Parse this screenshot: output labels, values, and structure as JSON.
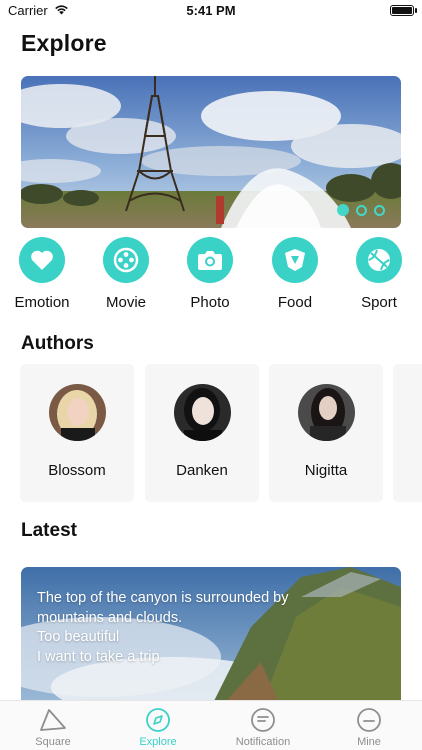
{
  "status_bar": {
    "carrier": "Carrier",
    "time": "5:41 PM",
    "battery_level": 1.0
  },
  "header": {
    "title": "Explore"
  },
  "banner": {
    "slides": 3,
    "active_slide": 1
  },
  "categories": [
    {
      "label": "Emotion",
      "icon": "heart-icon"
    },
    {
      "label": "Movie",
      "icon": "film-reel-icon"
    },
    {
      "label": "Photo",
      "icon": "camera-icon"
    },
    {
      "label": "Food",
      "icon": "food-icon"
    },
    {
      "label": "Sport",
      "icon": "ball-icon"
    }
  ],
  "authors": {
    "title": "Authors",
    "items": [
      {
        "name": "Blossom"
      },
      {
        "name": "Danken"
      },
      {
        "name": "Nigitta"
      }
    ]
  },
  "latest": {
    "title": "Latest",
    "text_lines": [
      "The top of the canyon is surrounded by",
      "mountains and clouds.",
      "Too beautiful",
      "I want to take a trip"
    ]
  },
  "tab_bar": {
    "items": [
      {
        "label": "Square",
        "icon": "triangle-icon",
        "active": false
      },
      {
        "label": "Explore",
        "icon": "compass-icon",
        "active": true
      },
      {
        "label": "Notification",
        "icon": "notification-icon",
        "active": false
      },
      {
        "label": "Mine",
        "icon": "profile-icon",
        "active": false
      }
    ]
  },
  "colors": {
    "accent": "#3ad2c7",
    "tab_inactive": "#8e8e8e",
    "card_bg": "#f6f6f6"
  }
}
